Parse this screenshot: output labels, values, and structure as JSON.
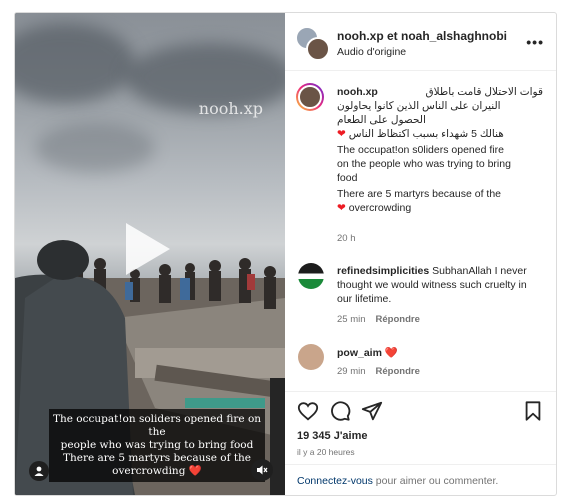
{
  "media": {
    "watermark": "nooh.xp",
    "caption_line1": "The occupat!on soliders opened fire on the",
    "caption_line2": "people who was trying to bring food",
    "caption_line3": "There are 5 martyrs because of the",
    "caption_line4": "overcrowding ❤️"
  },
  "header": {
    "names": "nooh.xp et noah_alshaghnobi",
    "audio": "Audio d'origine",
    "more": "•••"
  },
  "main_comment": {
    "username": "nooh.xp",
    "arabic_line1": "قوات الاحتلال قامت باطلاق",
    "arabic_line2": "النيران على الناس الذين كانوا يحاولون",
    "arabic_line3": "الحصول على الطعام",
    "arabic_line4": "هنالك 5 شهداء بسبب اكتظاظ الناس",
    "en_line1": "The occupat!on s0liders opened fire",
    "en_line2": "on the people who was trying to bring",
    "en_line3": "food",
    "en_line4": "There are 5 martyrs because of the",
    "en_line5": "overcrowding",
    "time": "20 h"
  },
  "comments": [
    {
      "username": "refinedsimplicities",
      "text": "SubhanAllah I never thought we would witness such cruelty in our lifetime.",
      "time": "25 min",
      "reply": "Répondre"
    },
    {
      "username": "pow_aim",
      "text": "❤️",
      "time": "29 min",
      "reply": "Répondre"
    }
  ],
  "actions": {
    "likes": "19 345 J'aime",
    "ago": "il y a 20 heures"
  },
  "login": {
    "link": "Connectez-vous",
    "rest": " pour aimer ou commenter."
  },
  "colors": {
    "heart": "#ed1c24",
    "link": "#00376b",
    "border": "#dbdbdb"
  }
}
